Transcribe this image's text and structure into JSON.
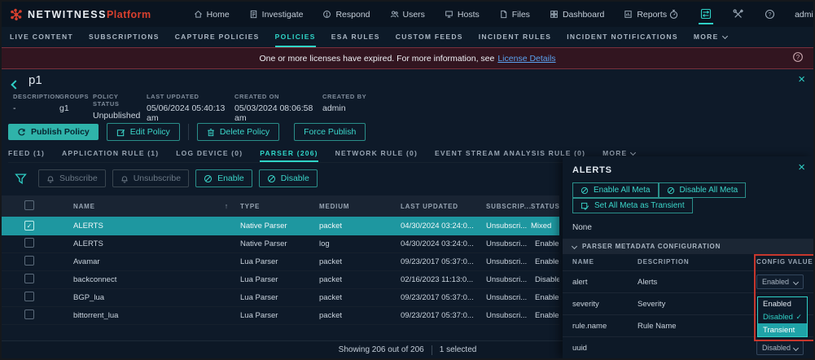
{
  "brand": {
    "primary": "NETWITNESS",
    "secondary": "Platform"
  },
  "topnav": {
    "items": [
      {
        "label": "Home",
        "icon": "home-icon"
      },
      {
        "label": "Investigate",
        "icon": "investigate-icon"
      },
      {
        "label": "Respond",
        "icon": "respond-icon"
      },
      {
        "label": "Users",
        "icon": "users-icon"
      },
      {
        "label": "Hosts",
        "icon": "hosts-icon"
      },
      {
        "label": "Files",
        "icon": "files-icon"
      },
      {
        "label": "Dashboard",
        "icon": "dashboard-icon"
      },
      {
        "label": "Reports",
        "icon": "reports-icon"
      }
    ],
    "right_icons": [
      "stopwatch-icon",
      "admin-config-icon",
      "tools-icon",
      "help-icon"
    ],
    "user": "admin"
  },
  "subnav": {
    "items": [
      {
        "label": "LIVE CONTENT"
      },
      {
        "label": "SUBSCRIPTIONS"
      },
      {
        "label": "CAPTURE POLICIES"
      },
      {
        "label": "POLICIES",
        "active": true
      },
      {
        "label": "ESA RULES"
      },
      {
        "label": "CUSTOM FEEDS"
      },
      {
        "label": "INCIDENT RULES"
      },
      {
        "label": "INCIDENT NOTIFICATIONS"
      }
    ],
    "more": "MORE"
  },
  "banner": {
    "message": "One or more licenses have expired. For more information, see",
    "link": "License Details"
  },
  "policy": {
    "title": "p1",
    "meta": [
      {
        "label": "DESCRIPTION",
        "value": "-"
      },
      {
        "label": "GROUPS",
        "value": "g1"
      },
      {
        "label": "POLICY STATUS",
        "value": "Unpublished"
      },
      {
        "label": "LAST UPDATED",
        "value": "05/06/2024 05:40:13 am"
      },
      {
        "label": "CREATED ON",
        "value": "05/03/2024 08:06:58 am"
      },
      {
        "label": "CREATED BY",
        "value": "admin"
      }
    ],
    "actions": {
      "publish": "Publish Policy",
      "edit": "Edit Policy",
      "delete": "Delete Policy",
      "force": "Force Publish"
    }
  },
  "tabs": [
    {
      "label": "FEED (1)"
    },
    {
      "label": "APPLICATION RULE (1)"
    },
    {
      "label": "LOG DEVICE (0)"
    },
    {
      "label": "PARSER (206)",
      "active": true
    },
    {
      "label": "NETWORK RULE (0)"
    },
    {
      "label": "EVENT STREAM ANALYSIS RULE (0)"
    },
    {
      "label": "MORE"
    }
  ],
  "toolbar": {
    "subscribe": "Subscribe",
    "unsubscribe": "Unsubscribe",
    "enable": "Enable",
    "disable": "Disable"
  },
  "table": {
    "columns": {
      "name": "NAME",
      "type": "TYPE",
      "medium": "MEDIUM",
      "updated": "LAST UPDATED",
      "subscription": "SUBSCRIP...",
      "status": "STATUS"
    },
    "rows": [
      {
        "name": "ALERTS",
        "type": "Native Parser",
        "medium": "packet",
        "updated": "04/30/2024 03:24:0...",
        "subscription": "Unsubscri...",
        "status": "Mixed",
        "status_kind": "mixed",
        "selected": true
      },
      {
        "name": "ALERTS",
        "type": "Native Parser",
        "medium": "log",
        "updated": "04/30/2024 03:24:0...",
        "subscription": "Unsubscri...",
        "status": "Enabled",
        "status_kind": "enabled"
      },
      {
        "name": "Avamar",
        "type": "Lua Parser",
        "medium": "packet",
        "updated": "09/23/2017 05:37:0...",
        "subscription": "Unsubscri...",
        "status": "Enabled",
        "status_kind": "enabled"
      },
      {
        "name": "backconnect",
        "type": "Lua Parser",
        "medium": "packet",
        "updated": "02/16/2023 11:13:0...",
        "subscription": "Unsubscri...",
        "status": "Disabled",
        "status_kind": "disabled"
      },
      {
        "name": "BGP_lua",
        "type": "Lua Parser",
        "medium": "packet",
        "updated": "09/23/2017 05:37:0...",
        "subscription": "Unsubscri...",
        "status": "Enabled",
        "status_kind": "enabled"
      },
      {
        "name": "bittorrent_lua",
        "type": "Lua Parser",
        "medium": "packet",
        "updated": "09/23/2017 05:37:0...",
        "subscription": "Unsubscri...",
        "status": "Enabled",
        "status_kind": "enabled"
      }
    ],
    "footer": {
      "showing": "Showing 206 out of 206",
      "selected": "1 selected"
    }
  },
  "panel": {
    "title": "ALERTS",
    "buttons": {
      "enable_all": "Enable All Meta",
      "disable_all": "Disable All Meta",
      "transient_all": "Set All Meta as Transient"
    },
    "none_label": "None",
    "section": "PARSER METADATA CONFIGURATION",
    "columns": {
      "name": "NAME",
      "description": "DESCRIPTION",
      "value": "CONFIG VALUE"
    },
    "rows": [
      {
        "name": "alert",
        "description": "Alerts",
        "value": "Enabled"
      },
      {
        "name": "severity",
        "description": "Severity",
        "value": ""
      },
      {
        "name": "rule.name",
        "description": "Rule Name",
        "value": ""
      },
      {
        "name": "uuid",
        "description": "",
        "value": "Disabled"
      }
    ],
    "dropdown": {
      "options": [
        {
          "label": "Enabled"
        },
        {
          "label": "Disabled",
          "checked": true
        },
        {
          "label": "Transient",
          "highlighted": true
        }
      ],
      "check_glyph": "✓"
    }
  },
  "glyphs": {
    "sort_up": "↑",
    "close": "×",
    "check": "✓"
  },
  "colors": {
    "accent_teal": "#2fd0c6",
    "selected_row": "#1e97a0",
    "filled_button": "#2fb3aa",
    "banner_bg": "#321520",
    "banner_border": "#79303c",
    "link_blue": "#5aa2f0",
    "status_enabled": "#43b04a",
    "status_disabled": "#d05959",
    "annotation_red": "#c8372d",
    "brand_red": "#d8402e"
  }
}
